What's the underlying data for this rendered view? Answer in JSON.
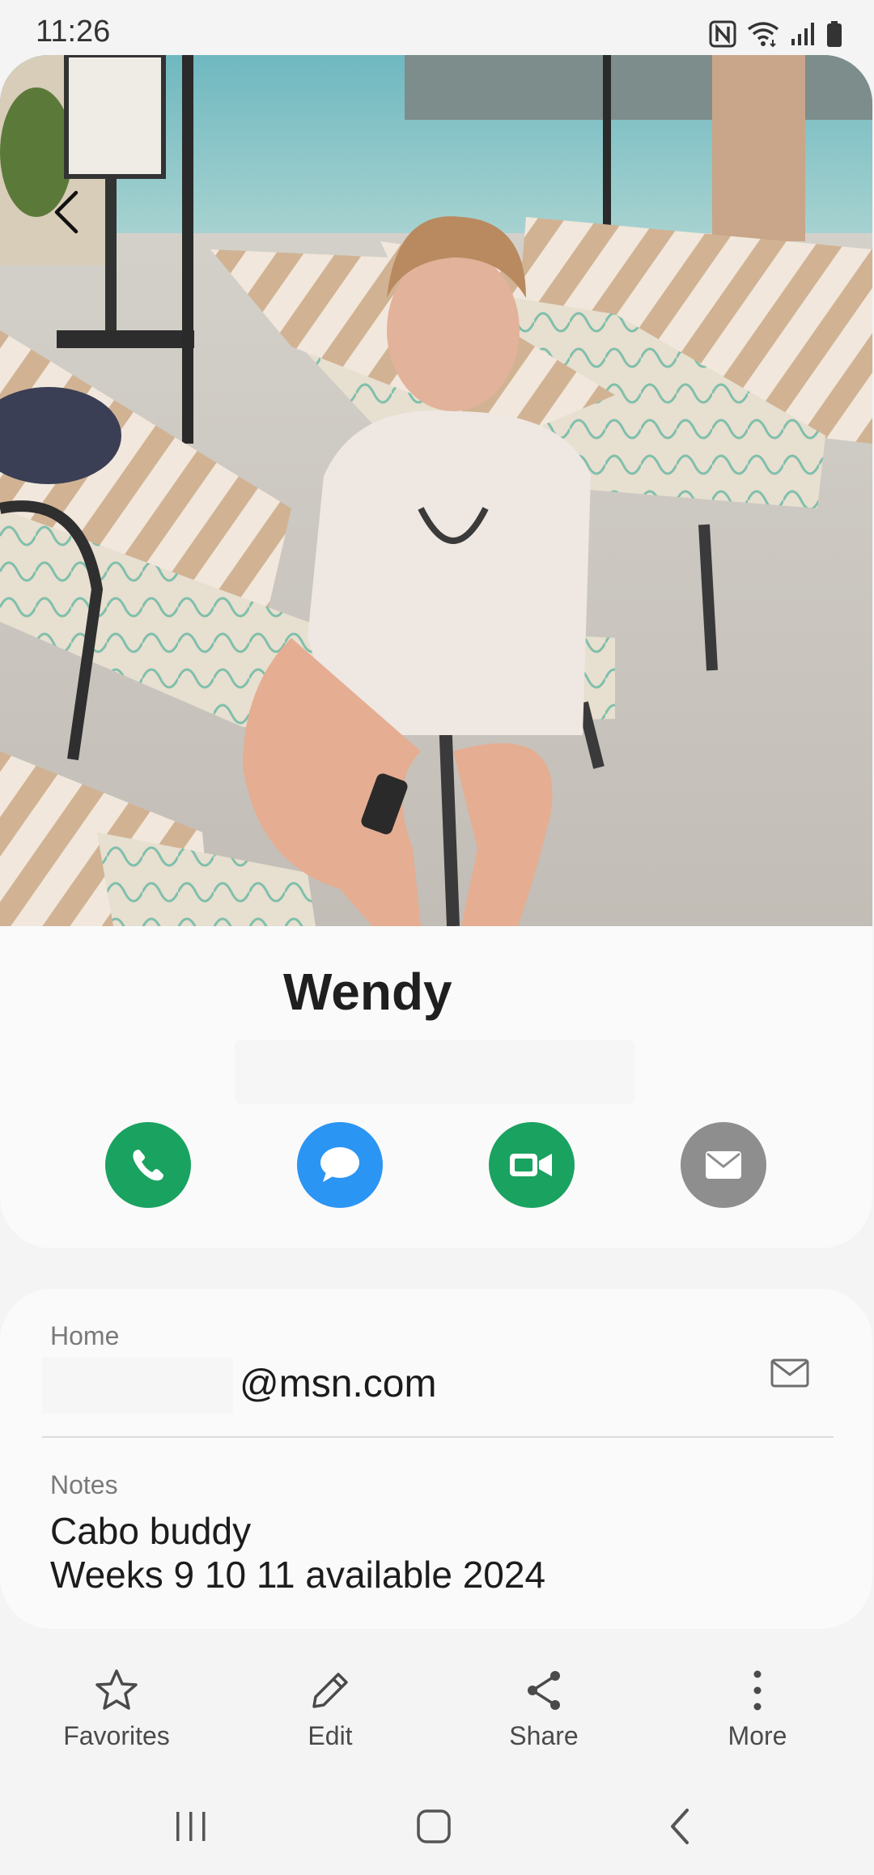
{
  "status_bar": {
    "time": "11:26",
    "icons": [
      "nfc-icon",
      "wifi-icon",
      "signal-icon",
      "battery-icon"
    ]
  },
  "header": {
    "back_icon": "chevron-left-icon",
    "photo_alt": "Contact photo",
    "contact_name": "Wendy"
  },
  "quick_actions": [
    {
      "name": "call",
      "icon": "phone-icon",
      "color": "#1aa260"
    },
    {
      "name": "message",
      "icon": "chat-bubble-icon",
      "color": "#2b95f3"
    },
    {
      "name": "video-call",
      "icon": "video-camera-icon",
      "color": "#1aa260"
    },
    {
      "name": "email",
      "icon": "envelope-icon",
      "color": "#8e8e8e"
    }
  ],
  "email_field": {
    "label": "Home",
    "value": "@msn.com",
    "action_icon": "envelope-outline-icon"
  },
  "notes_field": {
    "label": "Notes",
    "lines": [
      "Cabo buddy",
      "Weeks 9 10 11 available 2024"
    ]
  },
  "bottom_actions": [
    {
      "label": "Favorites",
      "icon": "star-icon"
    },
    {
      "label": "Edit",
      "icon": "pencil-icon"
    },
    {
      "label": "Share",
      "icon": "share-icon"
    },
    {
      "label": "More",
      "icon": "more-vertical-icon"
    }
  ],
  "nav_bar": [
    "recent-apps-icon",
    "home-icon",
    "back-icon"
  ]
}
